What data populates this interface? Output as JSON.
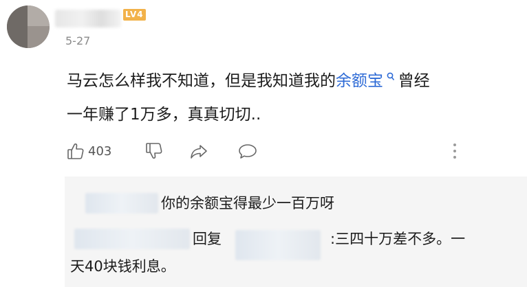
{
  "comment": {
    "level_badge": "LV4",
    "date": "5-27",
    "text_before_link": "马云怎么样我不知道，但是我知道我的",
    "link_text": "余额宝",
    "text_after_link": "曾经",
    "text_line2": "一年赚了1万多，真真切切..",
    "like_count": "403"
  },
  "replies": [
    {
      "text": "你的余额宝得最少一百万呀"
    },
    {
      "reply_word": "回复",
      "text_line1": ":三四十万差不多。一",
      "text_line2": "天40块钱利息。"
    }
  ],
  "icons": [
    "avatar",
    "search-icon",
    "thumbs-up-icon",
    "thumbs-down-icon",
    "share-icon",
    "comment-icon",
    "more-icon"
  ],
  "colors": {
    "link": "#2e6bd6",
    "badge": "#f2b24a",
    "reply_bg": "#f5f5f5"
  }
}
